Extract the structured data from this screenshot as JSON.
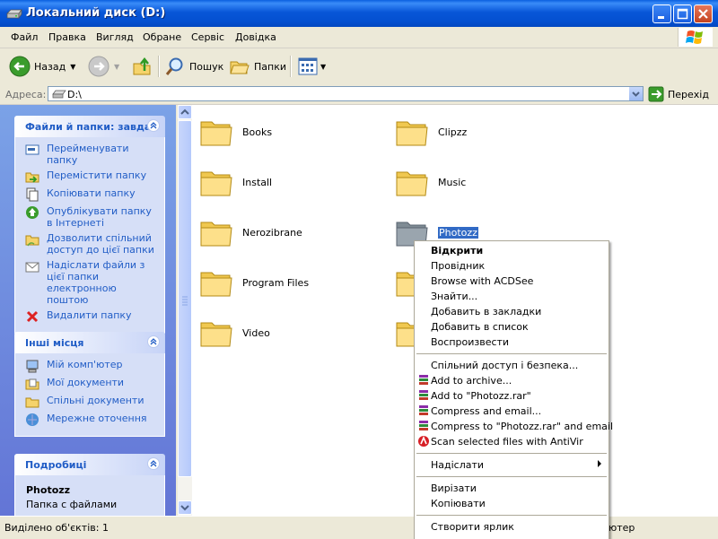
{
  "window": {
    "title": "Локальний диск (D:)"
  },
  "menubar": {
    "items": [
      "Файл",
      "Правка",
      "Вигляд",
      "Обране",
      "Сервіс",
      "Довідка"
    ]
  },
  "toolbar": {
    "back_label": "Назад",
    "search_label": "Пошук",
    "folders_label": "Папки"
  },
  "address": {
    "label": "Адреса:",
    "value": "D:\\",
    "go_label": "Перехід"
  },
  "tasks_box": {
    "title": "Файли й папки: завдан",
    "items": [
      "Перейменувати папку",
      "Перемістити папку",
      "Копіювати папку",
      "Опублікувати папку в Інтернеті",
      "Дозволити спільний доступ до цієї папки",
      "Надіслати файли з цієї папки електронною поштою",
      "Видалити папку"
    ]
  },
  "places_box": {
    "title": "Інші місця",
    "items": [
      "Мій комп'ютер",
      "Мої документи",
      "Спільні документи",
      "Мережне оточення"
    ]
  },
  "details_box": {
    "title": "Подробиці",
    "name": "Photozz",
    "type": "Папка с файлами"
  },
  "folders": [
    "Books",
    "Clipzz",
    "Install",
    "Music",
    "Nerozibrane",
    "Photozz",
    "Program Files",
    "Video"
  ],
  "context_menu": {
    "group1": [
      "Відкрити",
      "Провідник",
      "Browse with ACDSee",
      "Знайти...",
      "Добавить в закладки",
      "Добавить в список",
      "Воспроизвести"
    ],
    "group2": [
      "Спільний доступ і безпека...",
      "Add to archive...",
      "Add to \"Photozz.rar\"",
      "Compress and email...",
      "Compress to \"Photozz.rar\" and email",
      "Scan selected files with AntiVir"
    ],
    "send_to": "Надіслати",
    "group4": [
      "Вирізати",
      "Копіювати"
    ],
    "create_shortcut": "Створити ярлик"
  },
  "statusbar": {
    "left": "Виділено об'єктів: 1",
    "right": "ютер"
  },
  "colors": {
    "titlebar": "#0856d8",
    "task_link": "#215dc6",
    "panel_bg": "#7ba2e7",
    "selection": "#316ac5"
  }
}
